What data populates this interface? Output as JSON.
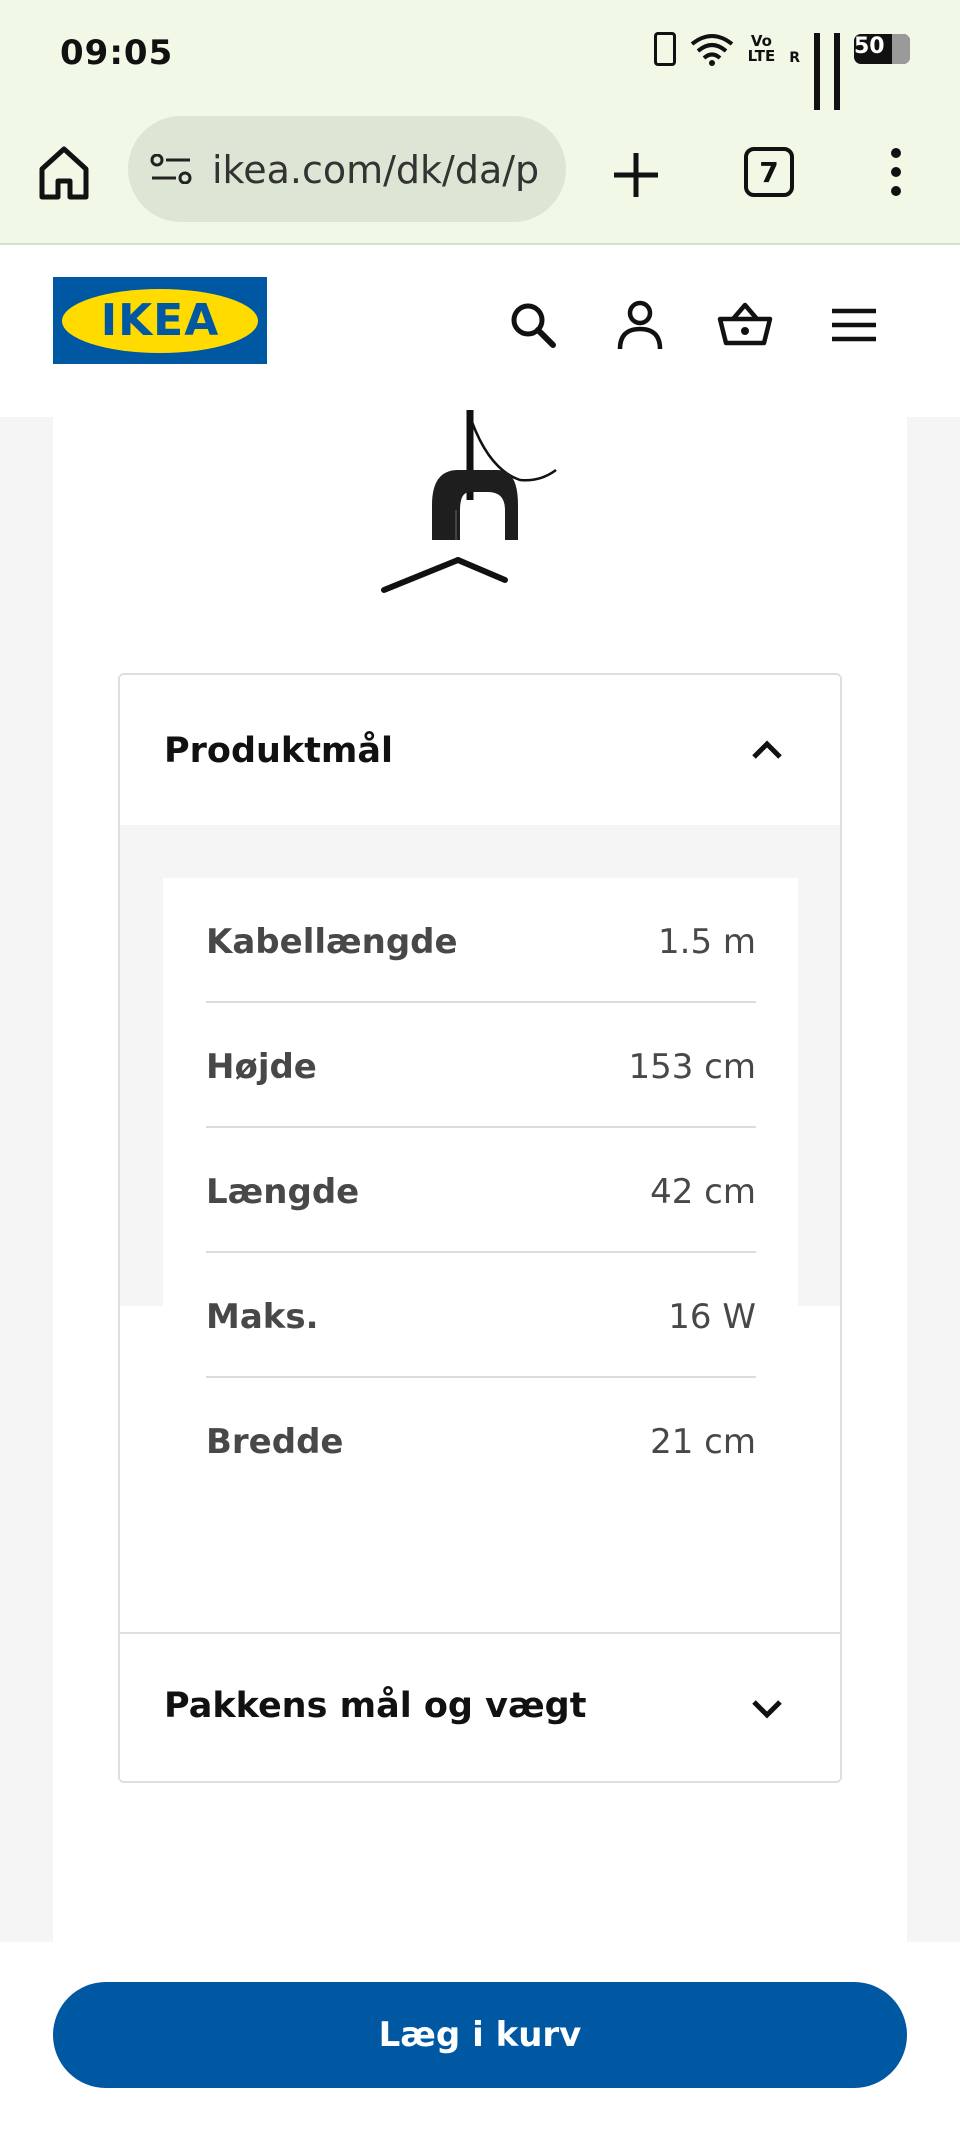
{
  "status_bar": {
    "time": "09:05",
    "volte": "Vo\nLTE",
    "roaming": "R",
    "battery_percent": "50"
  },
  "browser": {
    "url": "ikea.com/dk/da/p",
    "tab_count": "7"
  },
  "site_header": {
    "logo_text": "IKEA",
    "icons": [
      "search-icon",
      "user-icon",
      "basket-icon",
      "menu-icon"
    ],
    "brand_blue": "#0058a3",
    "brand_yellow": "#ffdb00"
  },
  "product_dimensions": {
    "title": "Produktmål",
    "expanded": true,
    "rows": [
      {
        "label": "Kabellængde",
        "value": "1.5 m"
      },
      {
        "label": "Højde",
        "value": "153 cm"
      },
      {
        "label": "Længde",
        "value": "42 cm"
      },
      {
        "label": "Maks.",
        "value": "16 W"
      },
      {
        "label": "Bredde",
        "value": "21 cm"
      }
    ]
  },
  "package_section": {
    "title": "Pakkens mål og vægt",
    "expanded": false
  },
  "add_to_cart": {
    "label": "Læg i kurv"
  }
}
